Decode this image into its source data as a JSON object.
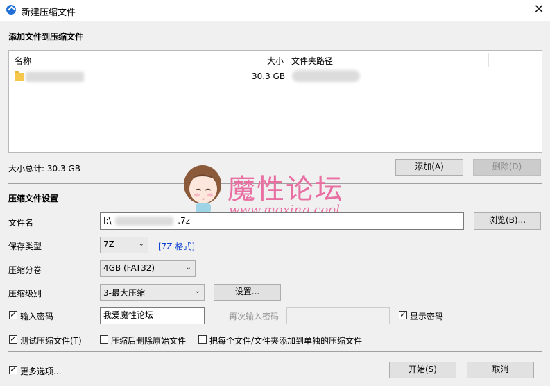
{
  "window": {
    "title": "新建压缩文件",
    "close_glyph": "✕"
  },
  "files_section": {
    "title": "添加文件到压缩文件",
    "columns": {
      "name": "名称",
      "size": "大小",
      "path": "文件夹路径"
    },
    "rows": [
      {
        "size": "30.3 GB"
      }
    ],
    "total_label": "大小总计: 30.3 GB",
    "add_button": "添加(A)",
    "delete_button": "删除(D)"
  },
  "settings": {
    "title": "压缩文件设置",
    "filename_label": "文件名",
    "filename_prefix": "I:\\",
    "filename_suffix": ".7z",
    "browse_button": "浏览(B)...",
    "type_label": "保存类型",
    "type_value": "7Z",
    "type_format": "[7Z 格式]",
    "split_label": "压缩分卷",
    "split_value": "4GB (FAT32)",
    "level_label": "压缩级别",
    "level_value": "3-最大压缩",
    "settings_button": "设置...",
    "password_label": "输入密码",
    "password_value": "我爱魔性论坛",
    "password_confirm_label": "再次输入密码",
    "show_password_label": "显示密码",
    "test_label": "测试压缩文件(T)",
    "delete_after_label": "压缩后删除原始文件",
    "separate_label": "把每个文件/文件夹添加到单独的压缩文件"
  },
  "footer": {
    "more_options_label": "更多选项...",
    "start_button": "开始(S)",
    "cancel_button": "取消"
  },
  "watermark": {
    "title": "魔性论坛",
    "url": "www.moxing.cool"
  },
  "checkbox_states": {
    "password": true,
    "show_password": true,
    "test": true,
    "delete_after": false,
    "separate": false,
    "more_options": true
  },
  "colors": {
    "accent": "#1f6fd6",
    "link": "#0b3fd1",
    "watermark": "#e96fa2",
    "folder": "#f5c84b"
  }
}
